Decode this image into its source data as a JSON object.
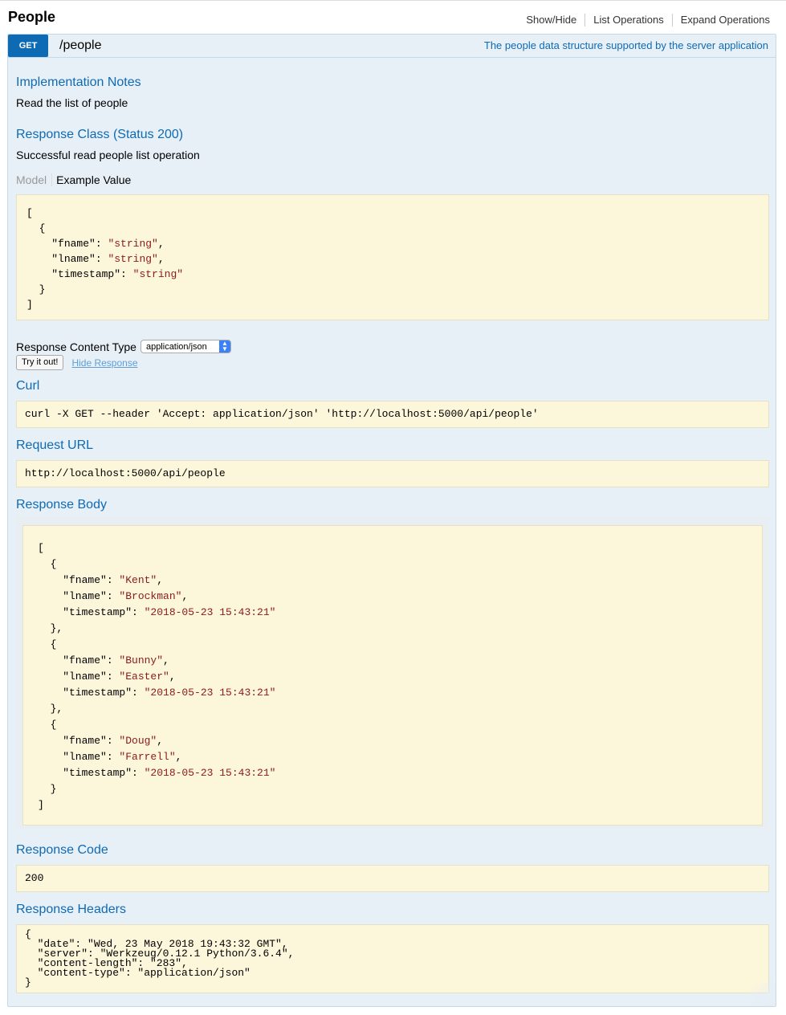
{
  "resource": {
    "title": "People",
    "links": [
      "Show/Hide",
      "List Operations",
      "Expand Operations"
    ]
  },
  "operation": {
    "method": "GET",
    "path": "/people",
    "summary": "The people data structure supported by the server application",
    "implementation_notes_title": "Implementation Notes",
    "implementation_notes": "Read the list of people",
    "response_class_title": "Response Class (Status 200)",
    "response_class_text": "Successful read people list operation",
    "model_tab": "Model",
    "example_tab": "Example Value",
    "example_lines": [
      {
        "k": "",
        "v": "",
        "pre": "[",
        "post": ""
      },
      {
        "k": "",
        "v": "",
        "pre": "  {",
        "post": ""
      },
      {
        "k": "\"fname\"",
        "v": "\"string\"",
        "pre": "    ",
        "post": ","
      },
      {
        "k": "\"lname\"",
        "v": "\"string\"",
        "pre": "    ",
        "post": ","
      },
      {
        "k": "\"timestamp\"",
        "v": "\"string\"",
        "pre": "    ",
        "post": ""
      },
      {
        "k": "",
        "v": "",
        "pre": "  }",
        "post": ""
      },
      {
        "k": "",
        "v": "",
        "pre": "]",
        "post": ""
      }
    ],
    "response_content_type_label": "Response Content Type",
    "response_content_type_value": "application/json",
    "try_button": "Try it out!",
    "hide_response": "Hide Response",
    "curl_title": "Curl",
    "curl": "curl -X GET --header 'Accept: application/json' 'http://localhost:5000/api/people'",
    "request_url_title": "Request URL",
    "request_url": "http://localhost:5000/api/people",
    "response_body_title": "Response Body",
    "people": [
      {
        "fname": "\"Kent\"",
        "lname": "\"Brockman\"",
        "timestamp": "\"2018-05-23 15:43:21\""
      },
      {
        "fname": "\"Bunny\"",
        "lname": "\"Easter\"",
        "timestamp": "\"2018-05-23 15:43:21\""
      },
      {
        "fname": "\"Doug\"",
        "lname": "\"Farrell\"",
        "timestamp": "\"2018-05-23 15:43:21\""
      }
    ],
    "response_code_title": "Response Code",
    "response_code": "200",
    "response_headers_title": "Response Headers",
    "response_headers": [
      "{",
      "  \"date\": \"Wed, 23 May 2018 19:43:32 GMT\",",
      "  \"server\": \"Werkzeug/0.12.1 Python/3.6.4\",",
      "  \"content-length\": \"283\",",
      "  \"content-type\": \"application/json\"",
      "}"
    ]
  }
}
